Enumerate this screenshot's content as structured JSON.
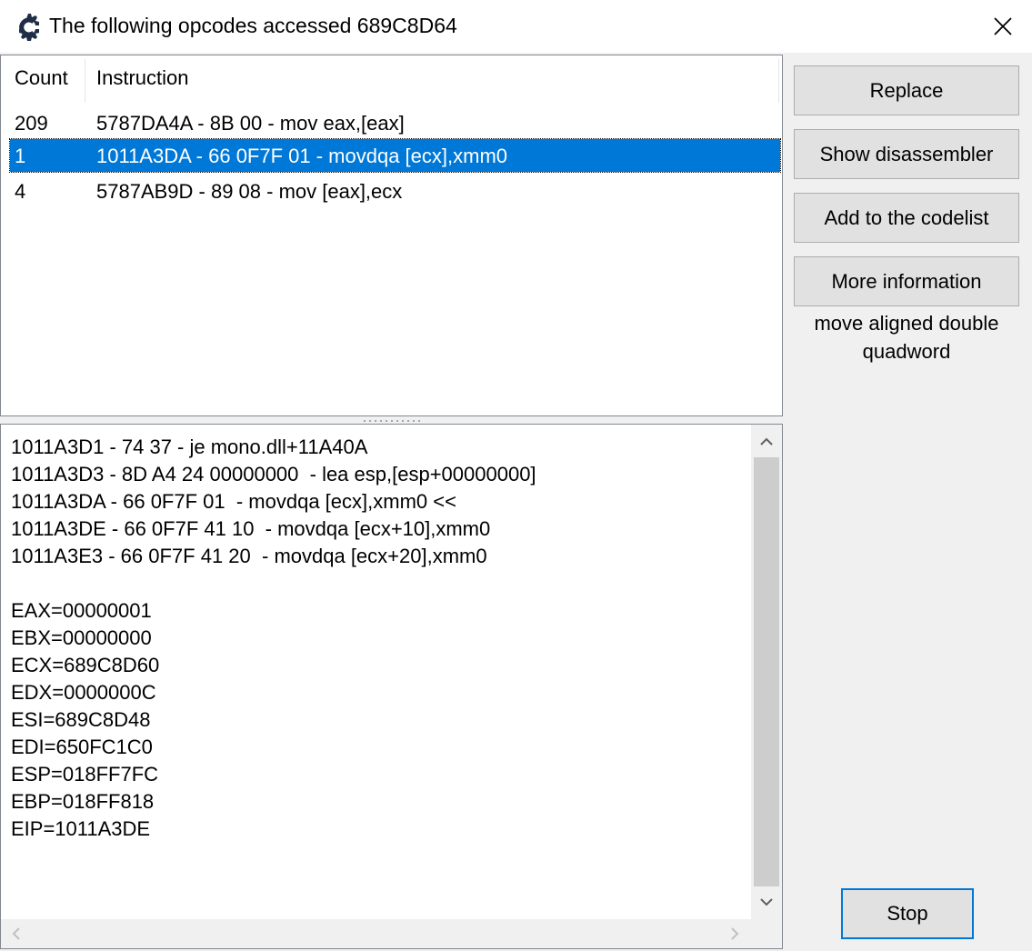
{
  "window": {
    "title": "The following opcodes accessed 689C8D64",
    "app_icon": "cheat-engine-icon",
    "close_icon": "close-icon"
  },
  "opcode_list": {
    "columns": [
      "Count",
      "Instruction"
    ],
    "rows": [
      {
        "count": "209",
        "instruction": "5787DA4A - 8B 00  - mov eax,[eax]",
        "selected": false
      },
      {
        "count": "1",
        "instruction": "1011A3DA - 66 0F7F 01  - movdqa [ecx],xmm0",
        "selected": true
      },
      {
        "count": "4",
        "instruction": "5787AB9D - 89 08  - mov [eax],ecx",
        "selected": false
      }
    ]
  },
  "details": {
    "lines": [
      "1011A3D1 - 74 37 - je mono.dll+11A40A",
      "1011A3D3 - 8D A4 24 00000000  - lea esp,[esp+00000000]",
      "1011A3DA - 66 0F7F 01  - movdqa [ecx],xmm0 <<",
      "1011A3DE - 66 0F7F 41 10  - movdqa [ecx+10],xmm0",
      "1011A3E3 - 66 0F7F 41 20  - movdqa [ecx+20],xmm0",
      "",
      "EAX=00000001",
      "EBX=00000000",
      "ECX=689C8D60",
      "EDX=0000000C",
      "ESI=689C8D48",
      "EDI=650FC1C0",
      "ESP=018FF7FC",
      "EBP=018FF818",
      "EIP=1011A3DE"
    ]
  },
  "buttons": {
    "replace": "Replace",
    "show_disassembler": "Show disassembler",
    "add_to_codelist": "Add to the codelist",
    "more_information": "More information",
    "stop": "Stop"
  },
  "instruction_info": {
    "line1": "move aligned double",
    "line2": "quadword"
  },
  "colors": {
    "selection": "#0078d7",
    "button_face": "#e1e1e1",
    "window_bg": "#f0f0f0"
  }
}
